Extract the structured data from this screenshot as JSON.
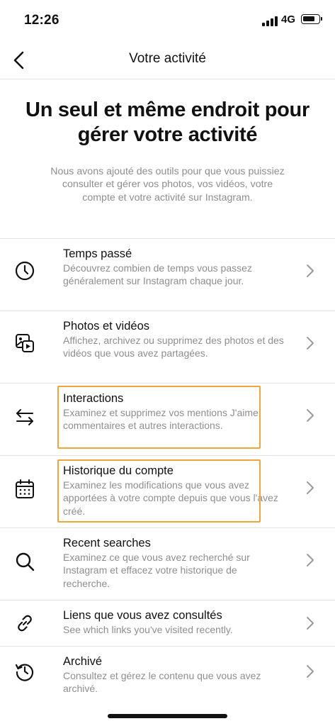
{
  "status_bar": {
    "time": "12:26",
    "network": "4G"
  },
  "nav": {
    "title": "Votre activité"
  },
  "headline": "Un seul et même endroit pour gérer votre activité",
  "intro": "Nous avons ajouté des outils pour que vous puissiez consulter et gérer vos photos, vos vidéos, votre compte et votre activité sur Instagram.",
  "items": [
    {
      "icon": "clock-icon",
      "title": "Temps passé",
      "description": "Découvrez combien de temps vous passez généralement sur Instagram chaque jour."
    },
    {
      "icon": "photos-videos-icon",
      "title": "Photos et vidéos",
      "description": "Affichez, archivez ou supprimez des photos et des vidéos que vous avez partagées."
    },
    {
      "icon": "arrows-exchange-icon",
      "title": "Interactions",
      "description": "Examinez et supprimez vos mentions J'aime, commentaires et autres interactions."
    },
    {
      "icon": "calendar-icon",
      "title": "Historique du compte",
      "description": "Examinez les modifications que vous avez apportées à votre compte depuis que vous l'avez créé."
    },
    {
      "icon": "search-icon",
      "title": "Recent searches",
      "description": "Examinez ce que vous avez recherché sur Instagram et effacez votre historique de recherche."
    },
    {
      "icon": "link-icon",
      "title": "Liens que vous avez consultés",
      "description": "See which links you've visited recently."
    },
    {
      "icon": "archive-history-icon",
      "title": "Archivé",
      "description": "Consultez et gérez le contenu que vous avez archivé."
    }
  ],
  "colors": {
    "highlight": "#f1a437",
    "secondary_text": "#8e8e8e",
    "divider": "#e2e2e2"
  }
}
